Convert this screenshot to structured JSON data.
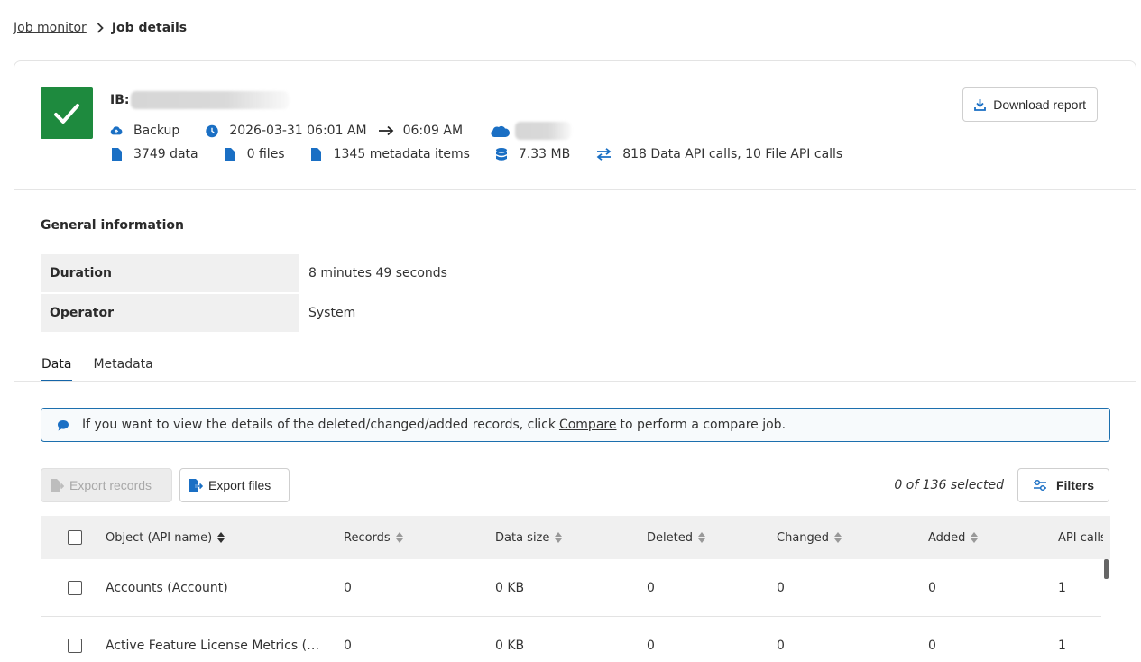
{
  "breadcrumb": {
    "parent": "Job monitor",
    "current": "Job details"
  },
  "job": {
    "id_prefix": "IB:",
    "type": "Backup",
    "start": "2026-03-31 06:01 AM",
    "end": "06:09 AM",
    "data_count": "3749 data",
    "files_count": "0 files",
    "metadata_count": "1345 metadata items",
    "size": "7.33 MB",
    "api_calls": "818 Data API calls, 10 File API calls",
    "status_color": "#1e8a3e"
  },
  "actions": {
    "download_report": "Download report"
  },
  "general": {
    "title": "General information",
    "rows": [
      {
        "label": "Duration",
        "value": "8 minutes 49 seconds"
      },
      {
        "label": "Operator",
        "value": "System"
      }
    ]
  },
  "tabs": [
    {
      "label": "Data"
    },
    {
      "label": "Metadata"
    }
  ],
  "banner": {
    "before": "If you want to view the details of the deleted/changed/added records, click",
    "link": "Compare",
    "after": "to perform a compare job."
  },
  "toolbar": {
    "export_records": "Export records",
    "export_files": "Export files",
    "selected": "0 of 136 selected",
    "filters": "Filters"
  },
  "table": {
    "columns": [
      "Object (API name)",
      "Records",
      "Data size",
      "Deleted",
      "Changed",
      "Added",
      "API calls"
    ],
    "rows": [
      {
        "name": "Accounts (Account)",
        "records": "0",
        "size": "0 KB",
        "deleted": "0",
        "changed": "0",
        "added": "0",
        "api": "1"
      },
      {
        "name": "Active Feature License Metrics (Ac...",
        "records": "0",
        "size": "0 KB",
        "deleted": "0",
        "changed": "0",
        "added": "0",
        "api": "1"
      }
    ]
  },
  "colors": {
    "accent": "#1565a8",
    "success": "#1e8a3e",
    "icon_blue": "#1a6fc4"
  }
}
